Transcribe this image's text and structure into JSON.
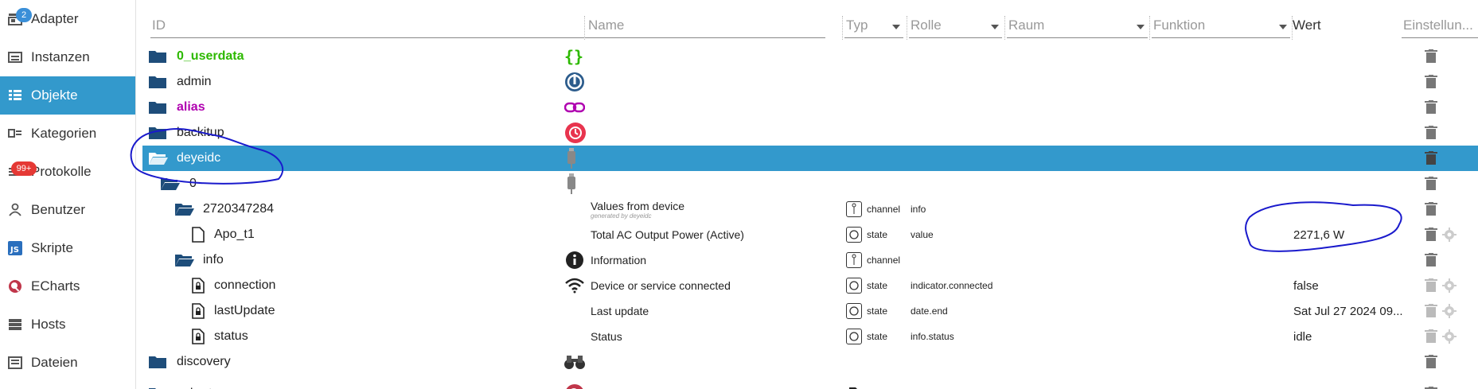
{
  "sidebar": {
    "items": [
      {
        "label": "Adapter",
        "icon": "store-icon",
        "badge": "2",
        "active": false
      },
      {
        "label": "Instanzen",
        "icon": "instances-icon",
        "active": false
      },
      {
        "label": "Objekte",
        "icon": "list-icon",
        "active": true
      },
      {
        "label": "Kategorien",
        "icon": "categories-icon",
        "active": false
      },
      {
        "label": "Protokolle",
        "icon": "logs-icon",
        "badge": "99+",
        "active": false
      },
      {
        "label": "Benutzer",
        "icon": "user-icon",
        "active": false
      },
      {
        "label": "Skripte",
        "icon": "js-icon",
        "active": false
      },
      {
        "label": "ECharts",
        "icon": "echarts-icon",
        "active": false
      },
      {
        "label": "Hosts",
        "icon": "hosts-icon",
        "active": false
      },
      {
        "label": "Dateien",
        "icon": "files-icon",
        "active": false
      }
    ]
  },
  "columns": {
    "id": "ID",
    "name": "Name",
    "type": "Typ",
    "role": "Rolle",
    "room": "Raum",
    "function": "Funktion",
    "value": "Wert",
    "settings": "Einstellun..."
  },
  "rows": [
    {
      "id": "0_userdata",
      "style": "green",
      "icon": "braces-icon"
    },
    {
      "id": "admin",
      "icon": "admin-power-icon"
    },
    {
      "id": "alias",
      "style": "purple",
      "icon": "link-icon"
    },
    {
      "id": "backitup",
      "icon": "clock-backup-icon"
    },
    {
      "id": "deyeidc",
      "icon": "device-plug-icon",
      "selected": true
    },
    {
      "id": "0",
      "icon": "device-plug-icon"
    },
    {
      "id": "2720347284",
      "name": "Values from device",
      "sub": "generated by deyeidc",
      "type": "channel",
      "role": "info"
    },
    {
      "id": "Apo_t1",
      "name": "Total AC Output Power (Active)",
      "type": "state",
      "role": "value",
      "value": "2271,6 W"
    },
    {
      "id": "info",
      "name": "Information",
      "type": "channel",
      "icon": "info-icon"
    },
    {
      "id": "connection",
      "name": "Device or service connected",
      "type": "state",
      "role": "indicator.connected",
      "value": "false",
      "icon": "wifi-icon"
    },
    {
      "id": "lastUpdate",
      "name": "Last update",
      "type": "state",
      "role": "date.end",
      "value": "Sat Jul 27 2024 09..."
    },
    {
      "id": "status",
      "name": "Status",
      "type": "state",
      "role": "info.status",
      "value": "idle"
    },
    {
      "id": "discovery",
      "icon": "binoculars-icon"
    },
    {
      "id": "echarts",
      "name": "echarts",
      "type": "meta",
      "icon": "echarts-icon"
    }
  ],
  "colors": {
    "accent": "#3399cc",
    "green": "#2db900",
    "purple": "#b000b0",
    "annotation": "#1a1acc"
  }
}
